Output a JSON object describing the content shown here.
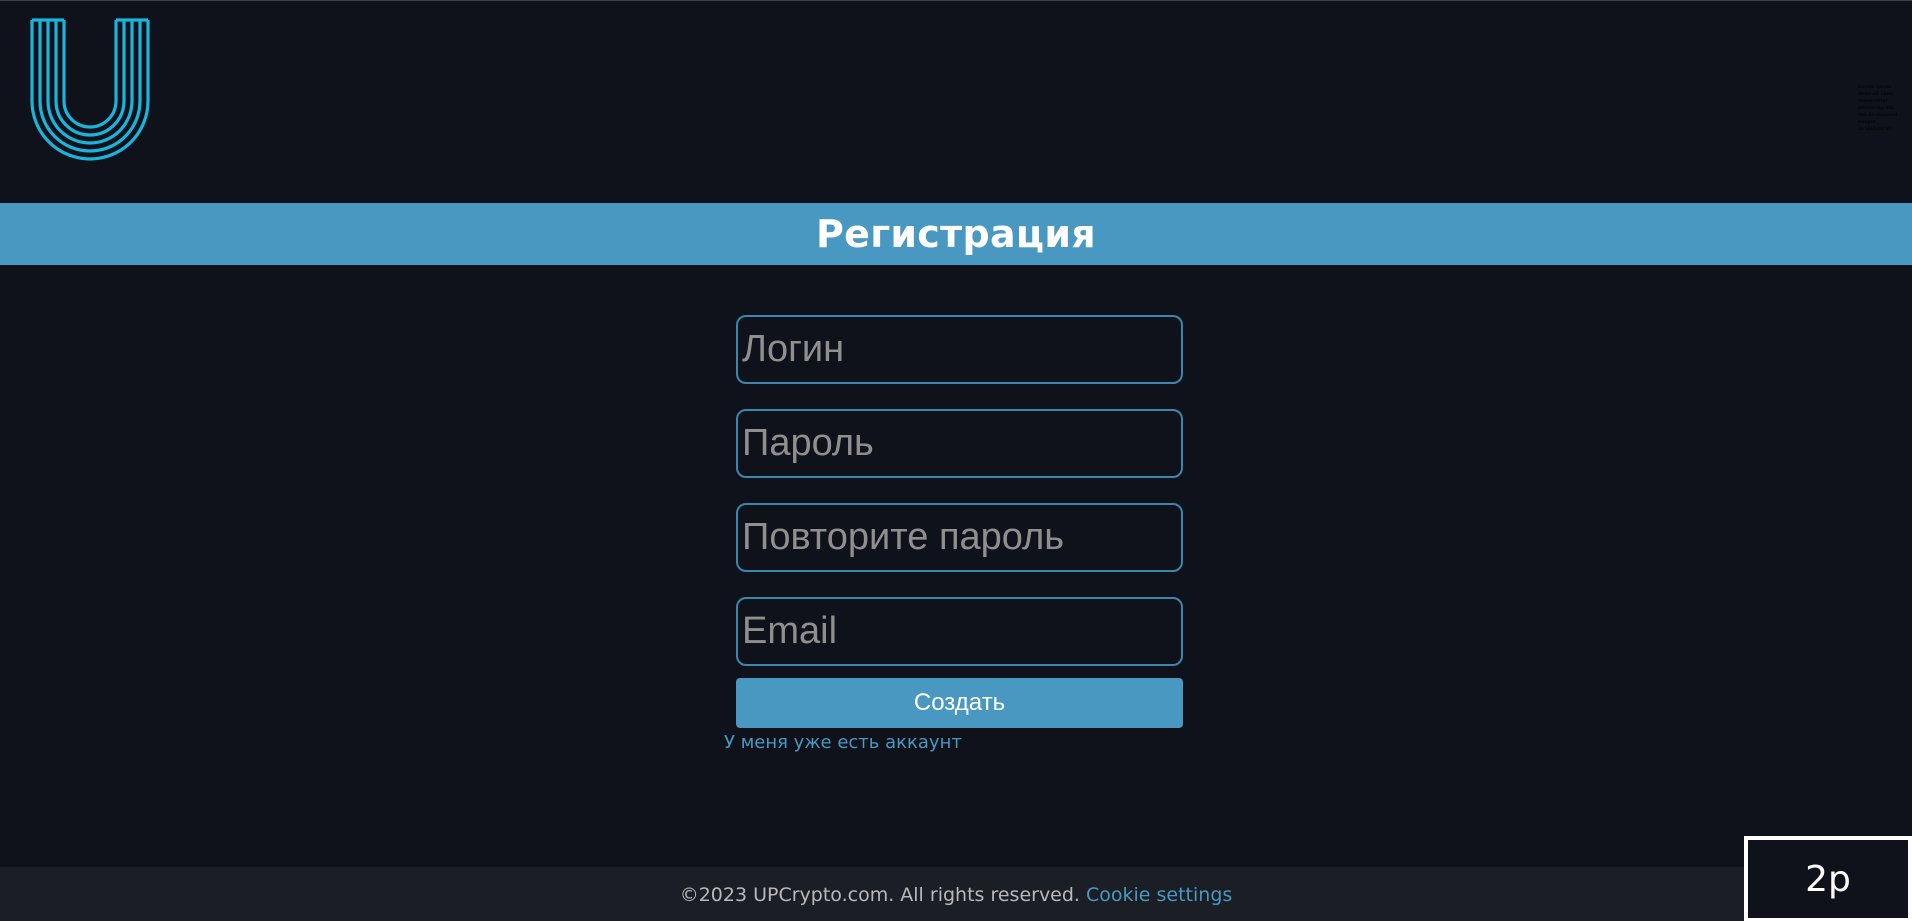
{
  "header": {
    "logo_icon": "u-logo-icon",
    "tiny_text": "Lorem ipsum\ndolor sit amet,\nconsectetur\nadipiscing elit,\nsed do eiusmod\ntempor\nincididunt ut"
  },
  "title": "Регистрация",
  "form": {
    "login_placeholder": "Логин",
    "password_placeholder": "Пароль",
    "repeat_password_placeholder": "Повторите пароль",
    "email_placeholder": "Email",
    "submit_label": "Создать",
    "have_account_link": "У меня уже есть аккаунт"
  },
  "footer": {
    "copyright": "©2023 UPCrypto.com. All rights reserved.",
    "cookie_link": "Cookie settings"
  },
  "corner_box": "2p",
  "colors": {
    "background": "#0f121a",
    "accent": "#4998c1",
    "logo": "#18b6dd",
    "footer_bg": "#1b1e24"
  }
}
